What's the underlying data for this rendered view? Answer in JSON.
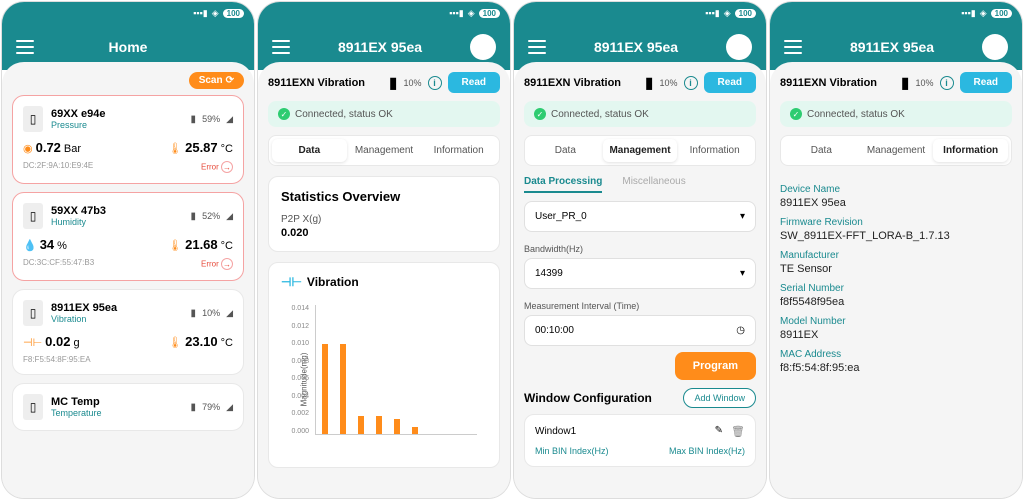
{
  "status_bar": {
    "battery": "100"
  },
  "screen1": {
    "title": "Home",
    "scan": "Scan",
    "devices": [
      {
        "name": "69XX e94e",
        "type": "Pressure",
        "batt": "59%",
        "v1_num": "0.72",
        "v1_unit": "Bar",
        "v2_num": "25.87",
        "v2_unit": "°C",
        "mac": "DC:2F:9A:10:E9:4E",
        "err": "Error"
      },
      {
        "name": "59XX 47b3",
        "type": "Humidity",
        "batt": "52%",
        "v1_num": "34",
        "v1_unit": "%",
        "v2_num": "21.68",
        "v2_unit": "°C",
        "mac": "DC:3C:CF:55:47:B3",
        "err": "Error"
      },
      {
        "name": "8911EX 95ea",
        "type": "Vibration",
        "batt": "10%",
        "v1_num": "0.02",
        "v1_unit": "g",
        "v2_num": "23.10",
        "v2_unit": "°C",
        "mac": "F8:F5:54:8F:95:EA",
        "err": ""
      },
      {
        "name": "MC Temp",
        "type": "Temperature",
        "batt": "79%"
      }
    ]
  },
  "common": {
    "header_title": "8911EX 95ea",
    "device_line": "8911EXN Vibration",
    "pct": "10%",
    "read": "Read",
    "status": "Connected, status OK",
    "tabs": {
      "data": "Data",
      "mgmt": "Management",
      "info": "Information"
    }
  },
  "screen2": {
    "stats_title": "Statistics Overview",
    "stat_label": "P2P X(g)",
    "stat_value": "0.020",
    "vib_title": "Vibration",
    "ylabel": "Magnitude(mg)"
  },
  "chart_data": {
    "type": "bar",
    "title": "Vibration",
    "ylabel": "Magnitude(mg)",
    "ylim": [
      0,
      0.014
    ],
    "yticks": [
      0.0,
      0.002,
      0.004,
      0.006,
      0.008,
      0.01,
      0.012,
      0.014
    ],
    "values": [
      0.0098,
      0.0098,
      0.002,
      0.002,
      0.0016,
      0.0008
    ]
  },
  "screen3": {
    "subtabs": {
      "dp": "Data Processing",
      "misc": "Miscellaneous"
    },
    "dp_value": "User_PR_0",
    "bw_label": "Bandwidth(Hz)",
    "bw_value": "14399",
    "mi_label": "Measurement Interval (Time)",
    "mi_value": "00:10:00",
    "program": "Program",
    "wc_title": "Window Configuration",
    "add_window": "Add Window",
    "window1": "Window1",
    "minbin": "Min BIN Index(Hz)",
    "maxbin": "Max BIN Index(Hz)"
  },
  "screen4": {
    "fields": [
      {
        "label": "Device Name",
        "value": "8911EX 95ea"
      },
      {
        "label": "Firmware Revision",
        "value": "SW_8911EX-FFT_LORA-B_1.7.13"
      },
      {
        "label": "Manufacturer",
        "value": "TE Sensor"
      },
      {
        "label": "Serial Number",
        "value": "f8f5548f95ea"
      },
      {
        "label": "Model Number",
        "value": "8911EX"
      },
      {
        "label": "MAC Address",
        "value": "f8:f5:54:8f:95:ea"
      }
    ]
  }
}
